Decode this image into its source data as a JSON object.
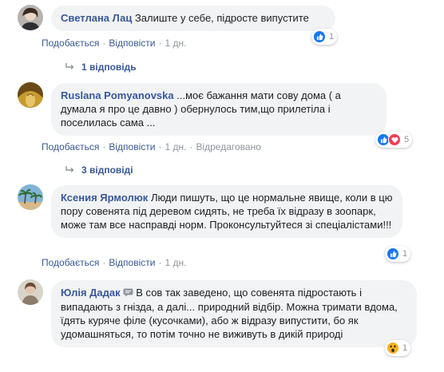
{
  "colors": {
    "link": "#385898",
    "meta": "#90949c",
    "bubble": "#f2f3f5",
    "like": "#1877f2",
    "love": "#f33e58",
    "wow": "#f7b125"
  },
  "comments": [
    {
      "author": "Светлана Лац",
      "text": "Залиште у себе, підросте випустите",
      "actions": [
        "Подобається",
        "Відповісти",
        "1 дн."
      ],
      "reactions": {
        "icons": [
          "like-icon"
        ],
        "count": "1"
      },
      "replies_label": "1 відповідь"
    },
    {
      "author": "Ruslana Pomyanovska",
      "text": "...моє бажання мати сову дома ( а думала я про це давно ) обернулось тим,що прилетіла і поселилась сама ...",
      "actions": [
        "Подобається",
        "Відповісти",
        "1 дн.",
        "Відредаговано"
      ],
      "reactions": {
        "icons": [
          "like-icon",
          "love-icon"
        ],
        "count": "5"
      },
      "replies_label": "3 відповіді"
    },
    {
      "author": "Ксения Ярмолюк",
      "text": "Люди пишуть, що це нормальне явище, коли в цю пору совенята під деревом сидять, не треба їх відразу в зоопарк, може там все насправді норм. Проконсультуйтеся зі спеціалістами!!!",
      "actions": [
        "Подобається",
        "Відповісти",
        "1 дн."
      ],
      "reactions": {
        "icons": [
          "like-icon"
        ],
        "count": "1"
      }
    },
    {
      "author": "Юлія Дадак",
      "text": "В сов так заведено, що совенята підростають і випадають з гнізда, а далі... природний відбір. Можна тримати вдома, їдять куряче філе (кусочками), або ж відразу випустити, бо як удомашняться, то потім точно не виживуть в дикій природі",
      "actions": [
        "Подобається",
        "Відповісти",
        "1 дн."
      ],
      "reactions": {
        "icons": [
          "wow-icon"
        ],
        "count": "1"
      }
    }
  ]
}
